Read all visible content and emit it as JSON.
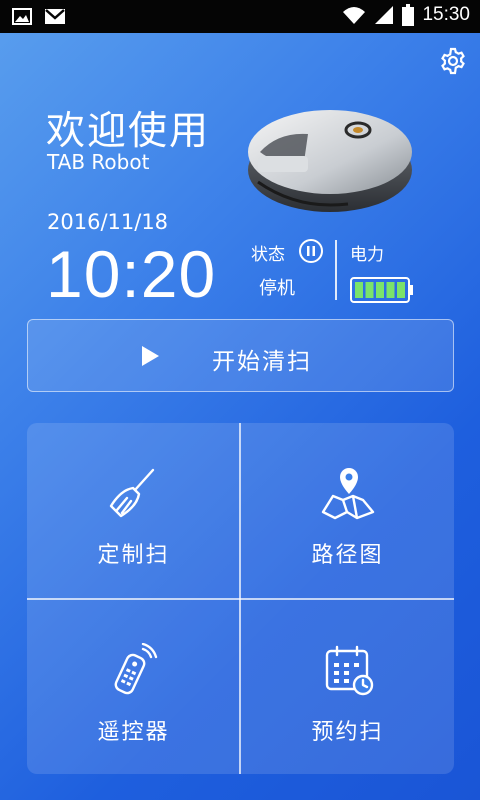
{
  "status_bar": {
    "time": "15:30",
    "icons": [
      "image-icon",
      "gmail-icon",
      "wifi-icon",
      "signal-icon",
      "battery-icon"
    ]
  },
  "header": {
    "welcome": "欢迎使用",
    "brand": "TAB Robot",
    "date": "2016/11/18",
    "time": "10:20",
    "settings_icon": "gear-icon"
  },
  "status": {
    "label": "状态",
    "value": "停机",
    "icon": "pause-circle-icon"
  },
  "power": {
    "label": "电力",
    "level": 1.0,
    "bar_color": "#7be36a"
  },
  "start": {
    "label": "开始清扫",
    "icon": "play-icon"
  },
  "grid": {
    "items": [
      {
        "label": "定制扫",
        "icon": "broom-icon"
      },
      {
        "label": "路径图",
        "icon": "map-pin-icon"
      },
      {
        "label": "遥控器",
        "icon": "remote-control-icon"
      },
      {
        "label": "预约扫",
        "icon": "calendar-clock-icon"
      }
    ]
  },
  "colors": {
    "bg_start": "#5a9fee",
    "bg_end": "#1a55d6",
    "status_bar": "#050505"
  }
}
